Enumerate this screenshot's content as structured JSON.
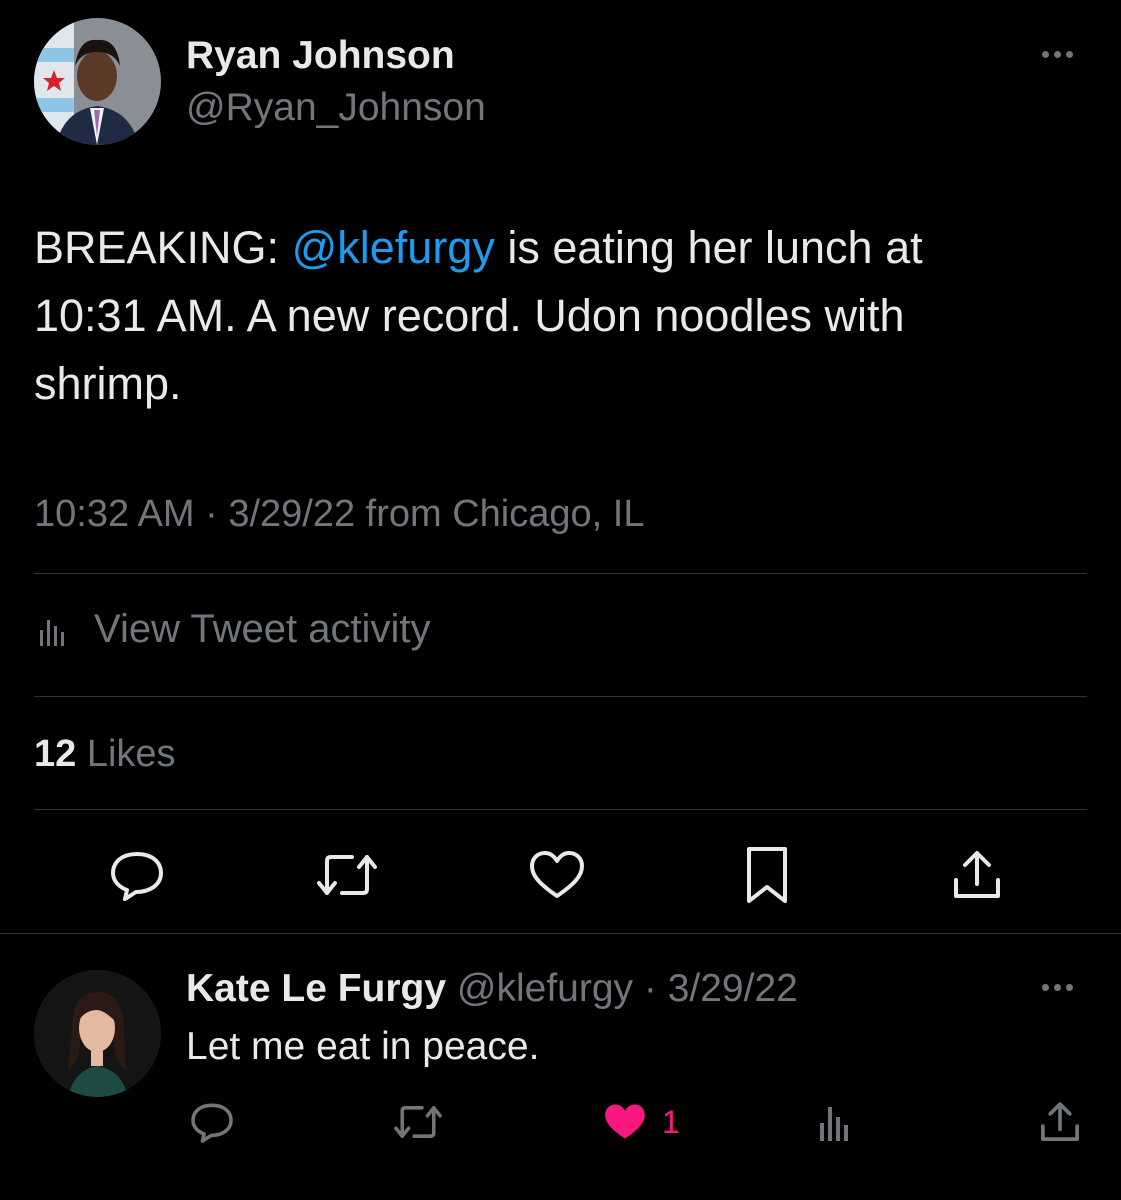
{
  "tweet": {
    "author_name": "Ryan Johnson",
    "author_handle": "@Ryan_Johnson",
    "text_prefix": "BREAKING: ",
    "mention": "@klefurgy",
    "text_suffix": " is eating her lunch at 10:31 AM. A new record. Udon noodles with shrimp.",
    "meta": "10:32 AM · 3/29/22 from Chicago, IL",
    "activity_label": "View Tweet activity",
    "likes_count": "12",
    "likes_label": " Likes"
  },
  "reply": {
    "author_name": "Kate Le Furgy",
    "author_handle": "@klefurgy",
    "date": " · 3/29/22",
    "text": "Let me eat in peace.",
    "like_count": "1"
  },
  "colors": {
    "background": "#000000",
    "text": "#e7e9ea",
    "muted": "#71767b",
    "link": "#1d9bf0",
    "like": "#f91880",
    "divider": "#2f3336"
  },
  "icons": [
    "more-icon",
    "activity-icon",
    "reply-icon",
    "retweet-icon",
    "like-icon",
    "bookmark-icon",
    "share-icon",
    "analytics-icon"
  ]
}
